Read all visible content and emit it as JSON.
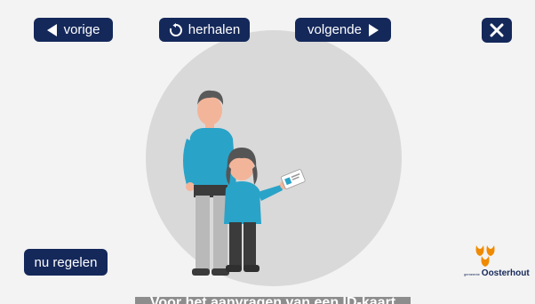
{
  "nav": {
    "prev_label": "vorige",
    "repeat_label": "herhalen",
    "next_label": "volgende",
    "close_icon": "close-icon"
  },
  "action": {
    "now_label": "nu regelen"
  },
  "logo": {
    "small_text": "gemeente",
    "name": "Oosterhout"
  },
  "caption": {
    "text": "Voor het aanvragen van een ID-kaart"
  },
  "colors": {
    "button_bg": "#14285a",
    "button_text": "#ffffff",
    "circle": "#d9d9d9",
    "logo_orange": "#f08a00",
    "background": "#f3f3f3"
  }
}
